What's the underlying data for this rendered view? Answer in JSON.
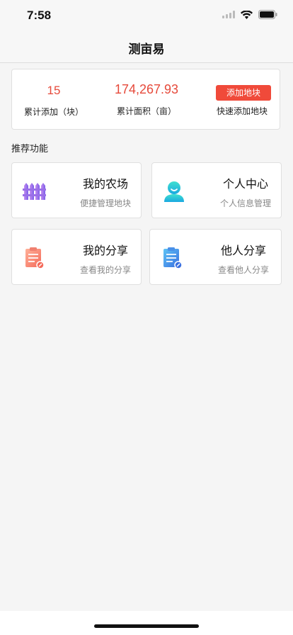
{
  "status_bar": {
    "time": "7:58"
  },
  "nav": {
    "title": "测亩易"
  },
  "summary": {
    "added_count": "15",
    "added_label": "累计添加（块）",
    "total_area": "174,267.93",
    "total_area_label": "累计面积（亩）",
    "add_button_label": "添加地块",
    "quick_add_label": "快速添加地块"
  },
  "section": {
    "title": "推荐功能"
  },
  "features": [
    {
      "title": "我的农场",
      "subtitle": "便捷管理地块",
      "icon": "fence-icon"
    },
    {
      "title": "个人中心",
      "subtitle": "个人信息管理",
      "icon": "user-icon"
    },
    {
      "title": "我的分享",
      "subtitle": "查看我的分享",
      "icon": "clipboard-edit-icon"
    },
    {
      "title": "他人分享",
      "subtitle": "查看他人分享",
      "icon": "clipboard-edit-icon"
    }
  ],
  "colors": {
    "accent": "#f04a3a",
    "stat_red": "#e64a3b"
  }
}
